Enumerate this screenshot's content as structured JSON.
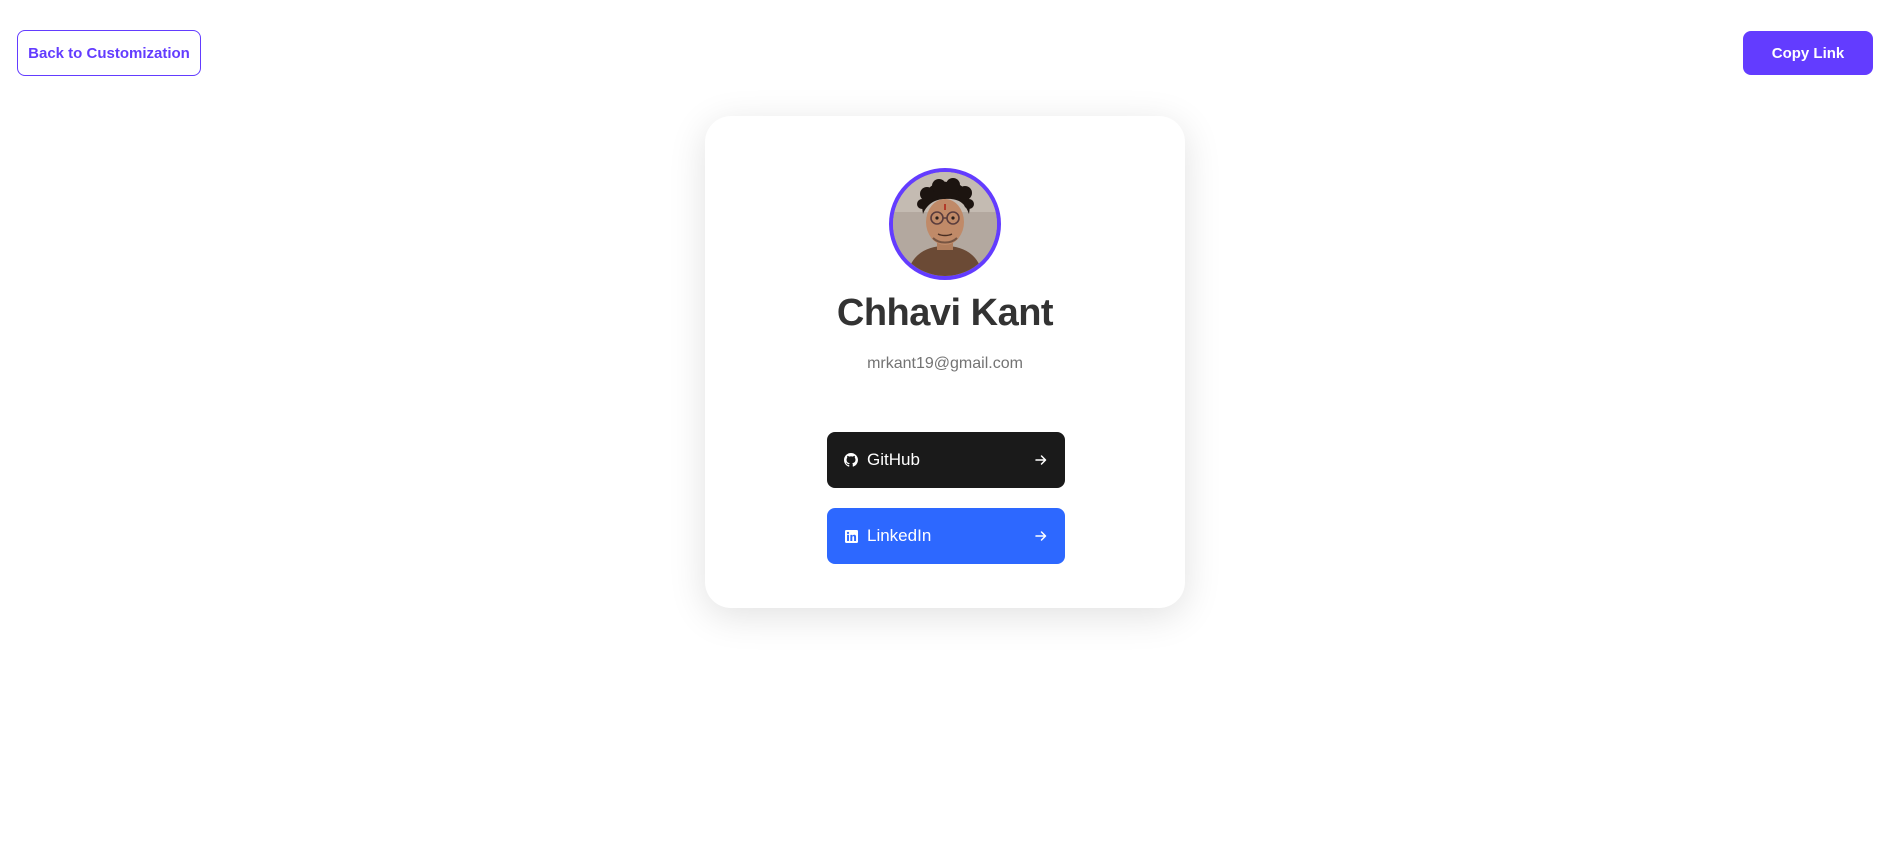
{
  "header": {
    "back_label": "Back to Customization",
    "copy_label": "Copy Link"
  },
  "profile": {
    "name": "Chhavi Kant",
    "email": "mrkant19@gmail.com",
    "avatar_icon": "profile-photo"
  },
  "links": [
    {
      "label": "GitHub",
      "icon": "github-icon",
      "color": "#1a1a1a"
    },
    {
      "label": "LinkedIn",
      "icon": "linkedin-icon",
      "color": "#2d68ff"
    }
  ],
  "colors": {
    "accent": "#633cff",
    "heading": "#333333",
    "muted": "#737373"
  }
}
